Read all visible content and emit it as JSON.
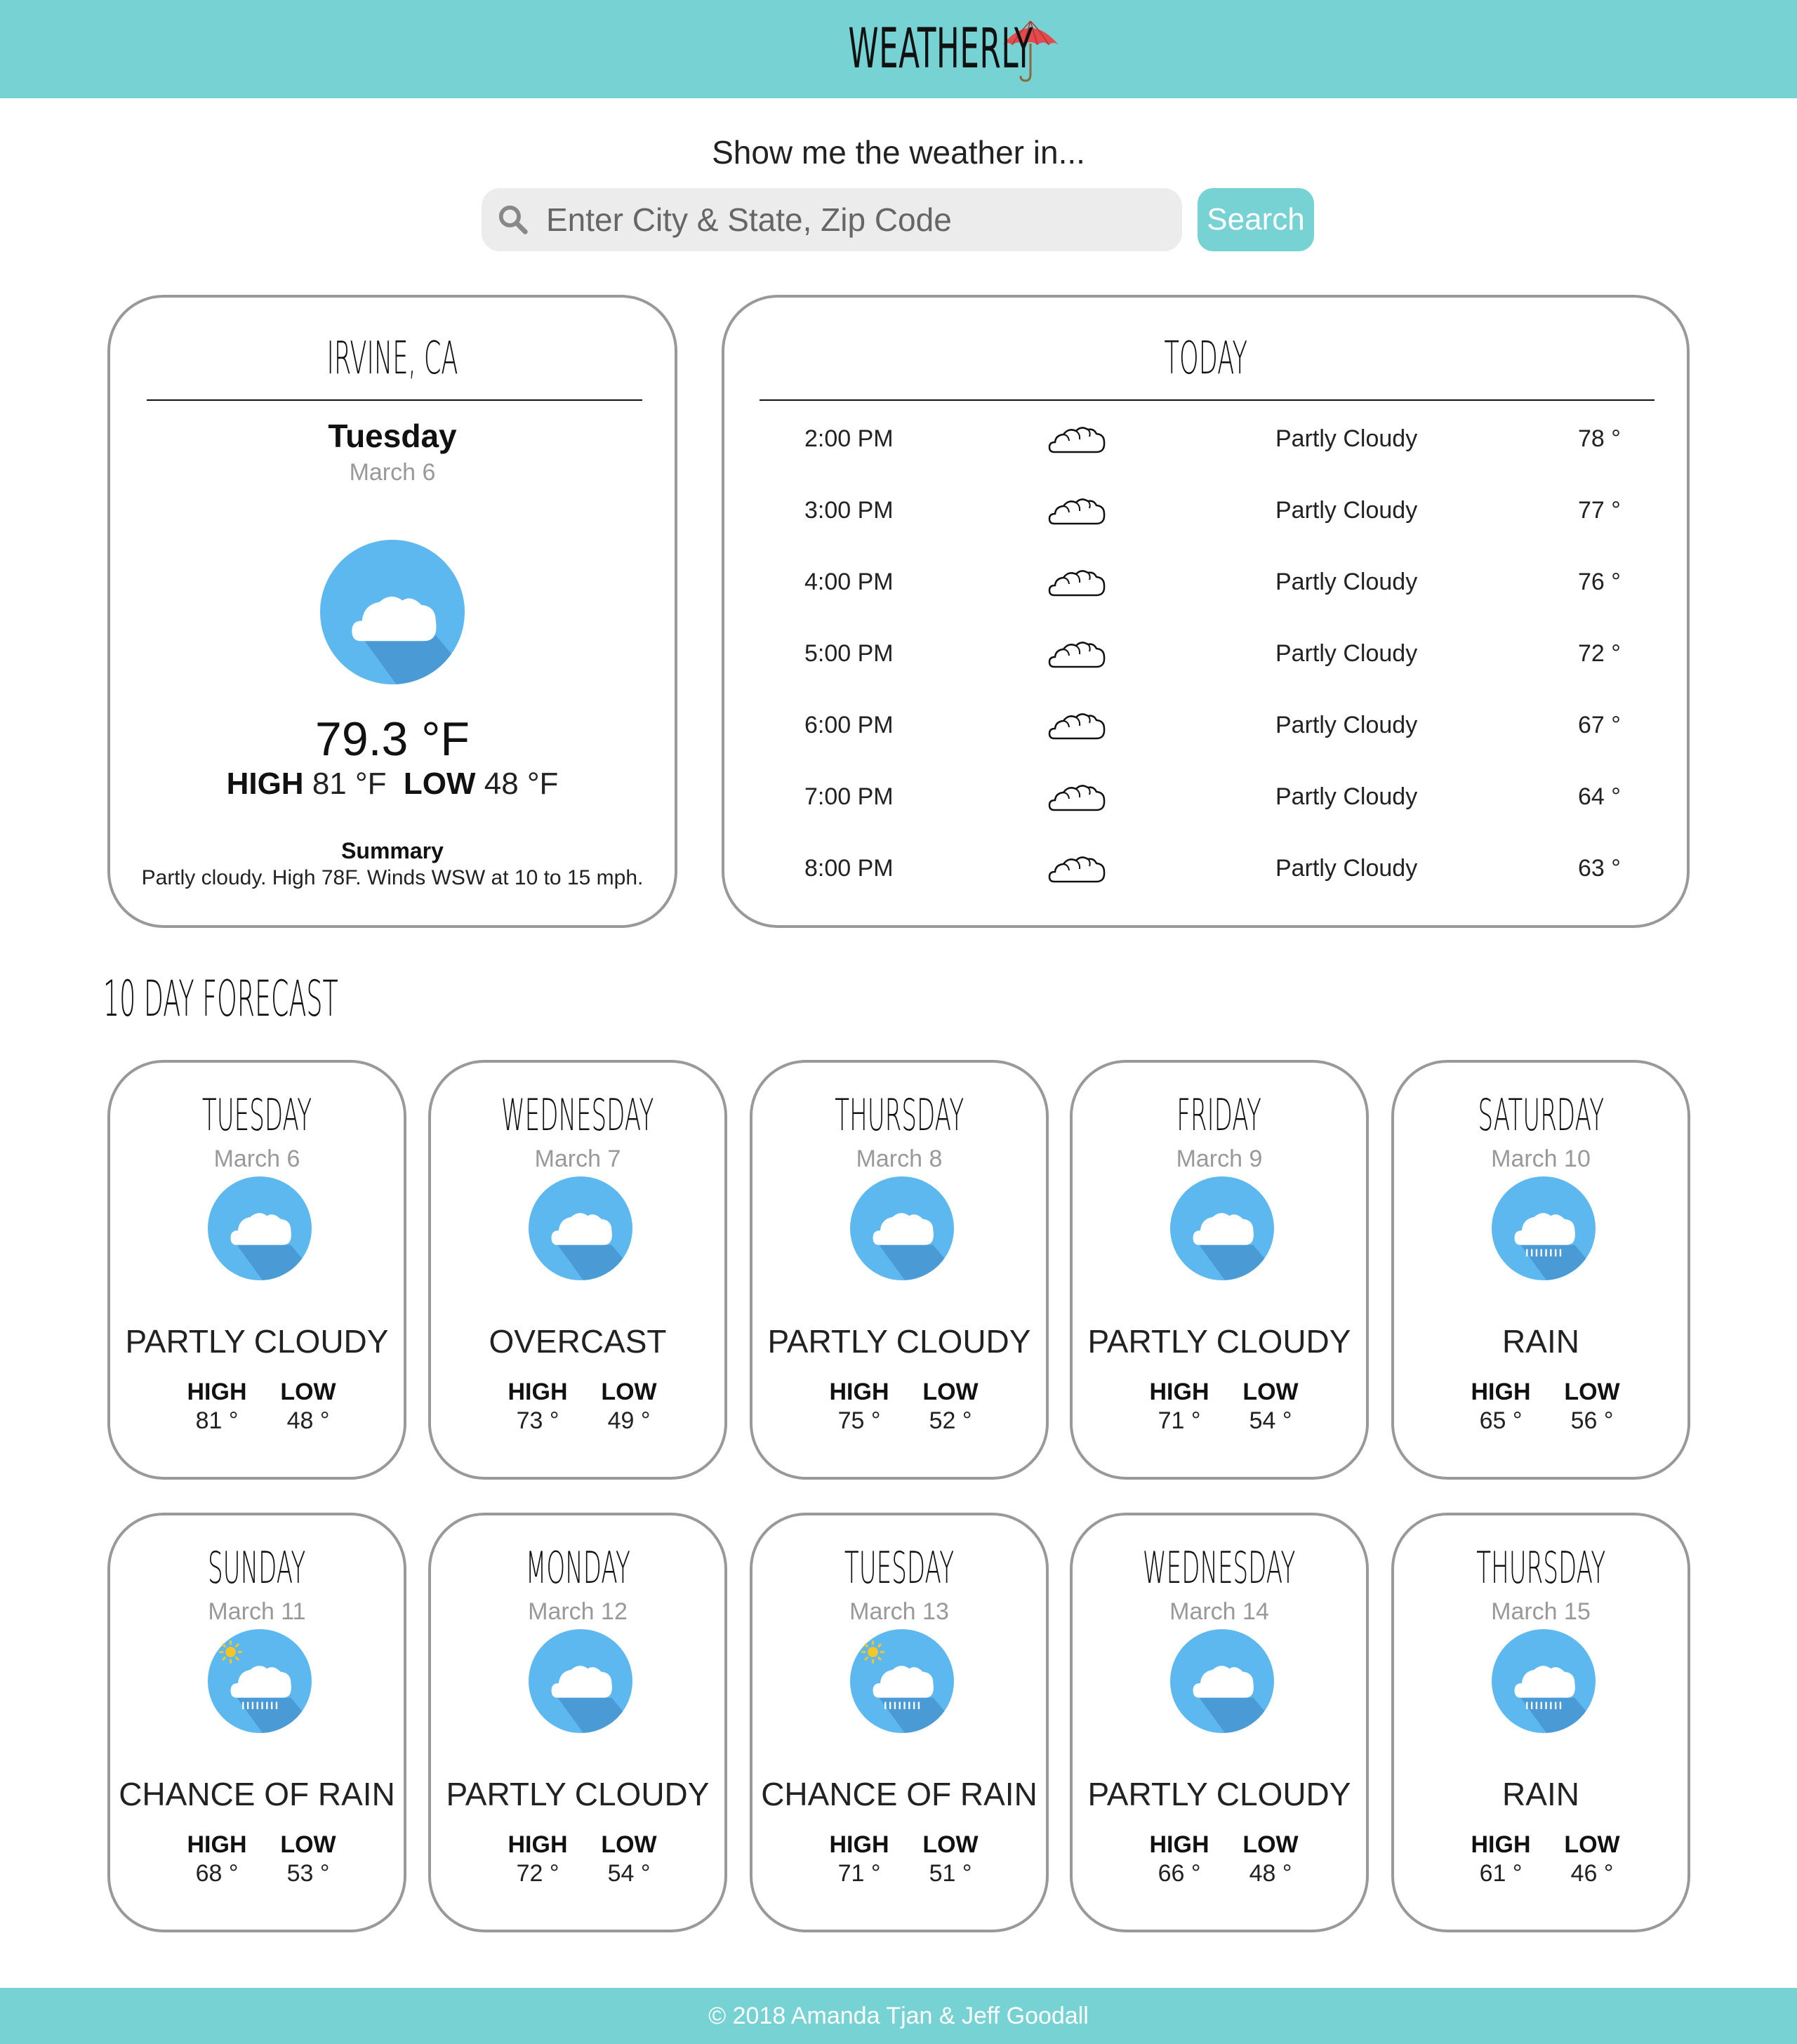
{
  "header": {
    "logo_text": "WEATHERLY",
    "logo_icon": "umbrella-icon"
  },
  "search": {
    "prompt": "Show me the weather in...",
    "placeholder": "Enter City & State, Zip Code",
    "value": "",
    "button_label": "Search",
    "icon": "search-icon"
  },
  "current": {
    "location": "IRVINE, CA",
    "day": "Tuesday",
    "date": "March 6",
    "icon": "partly-cloudy-icon",
    "temperature": "79.3 °F",
    "high_label": "HIGH",
    "high": "81 °F",
    "low_label": "LOW",
    "low": "48 °F",
    "summary_label": "Summary",
    "summary": "Partly cloudy. High 78F. Winds WSW at 10 to 15 mph."
  },
  "today": {
    "title": "TODAY",
    "hours": [
      {
        "time": "2:00 PM",
        "icon": "cloud-outline-icon",
        "condition": "Partly Cloudy",
        "temp": "78 °"
      },
      {
        "time": "3:00 PM",
        "icon": "cloud-outline-icon",
        "condition": "Partly Cloudy",
        "temp": "77 °"
      },
      {
        "time": "4:00 PM",
        "icon": "cloud-outline-icon",
        "condition": "Partly Cloudy",
        "temp": "76 °"
      },
      {
        "time": "5:00 PM",
        "icon": "cloud-outline-icon",
        "condition": "Partly Cloudy",
        "temp": "72 °"
      },
      {
        "time": "6:00 PM",
        "icon": "cloud-outline-icon",
        "condition": "Partly Cloudy",
        "temp": "67 °"
      },
      {
        "time": "7:00 PM",
        "icon": "cloud-outline-icon",
        "condition": "Partly Cloudy",
        "temp": "64 °"
      },
      {
        "time": "8:00 PM",
        "icon": "cloud-outline-icon",
        "condition": "Partly Cloudy",
        "temp": "63 °"
      }
    ]
  },
  "forecast": {
    "title": "10 DAY FORECAST",
    "high_label": "HIGH",
    "low_label": "LOW",
    "days": [
      {
        "day": "TUESDAY",
        "date": "March 6",
        "icon": "partly-cloudy-icon",
        "condition": "PARTLY CLOUDY",
        "high": "81 °",
        "low": "48 °"
      },
      {
        "day": "WEDNESDAY",
        "date": "March 7",
        "icon": "overcast-icon",
        "condition": "OVERCAST",
        "high": "73 °",
        "low": "49 °"
      },
      {
        "day": "THURSDAY",
        "date": "March 8",
        "icon": "partly-cloudy-icon",
        "condition": "PARTLY CLOUDY",
        "high": "75 °",
        "low": "52 °"
      },
      {
        "day": "FRIDAY",
        "date": "March 9",
        "icon": "partly-cloudy-icon",
        "condition": "PARTLY CLOUDY",
        "high": "71 °",
        "low": "54 °"
      },
      {
        "day": "SATURDAY",
        "date": "March 10",
        "icon": "rain-icon",
        "condition": "RAIN",
        "high": "65 °",
        "low": "56 °"
      },
      {
        "day": "SUNDAY",
        "date": "March 11",
        "icon": "chance-of-rain-icon",
        "condition": "CHANCE OF RAIN",
        "high": "68 °",
        "low": "53 °"
      },
      {
        "day": "MONDAY",
        "date": "March 12",
        "icon": "partly-cloudy-icon",
        "condition": "PARTLY CLOUDY",
        "high": "72 °",
        "low": "54 °"
      },
      {
        "day": "TUESDAY",
        "date": "March 13",
        "icon": "chance-of-rain-icon",
        "condition": "CHANCE OF RAIN",
        "high": "71 °",
        "low": "51 °"
      },
      {
        "day": "WEDNESDAY",
        "date": "March 14",
        "icon": "partly-cloudy-icon",
        "condition": "PARTLY CLOUDY",
        "high": "66 °",
        "low": "48 °"
      },
      {
        "day": "THURSDAY",
        "date": "March 15",
        "icon": "rain-icon",
        "condition": "RAIN",
        "high": "61 °",
        "low": "46 °"
      }
    ]
  },
  "footer": {
    "text": "© 2018 Amanda Tjan & Jeff Goodall"
  },
  "colors": {
    "accent": "#77d2d4",
    "icon_circle": "#5eb8f0",
    "icon_shadow": "#4a9ad6",
    "sun": "#f5c623",
    "card_border": "#999999",
    "muted_text": "#999999"
  }
}
